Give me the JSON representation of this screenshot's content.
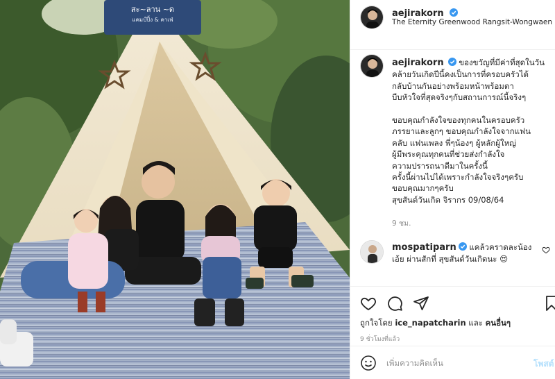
{
  "post": {
    "username": "aejirakorn",
    "location": "The Eternity Greenwood Rangsit-Wongwaen",
    "caption_lines_1": [
      "ของขวัญที่มีค่าที่สุดในวัน",
      "คล้ายวันเกิดปีนี้คงเป็นการที่ครอบครัวได้",
      "กลับบ้านกันอย่างพร้อมหน้าพร้อมตา",
      "บีบหัวใจที่สุดจริงๆกับสถานการณ์นี้จริงๆ"
    ],
    "caption_lines_2": [
      "ขอบคุณกำลังใจของทุกคนในครอบครัว",
      "ภรรยาและลูกๆ ขอบคุณกำลังใจจากแฟน",
      "คลับ แฟนเพลง พี่ๆน้องๆ ผู้หลักผู้ใหญ่",
      "ผู้มีพระคุณทุกคนที่ช่วยส่งกำลังใจ",
      "ความปรารถนาดีมาในครั้งนี้",
      "ครั้งนี้ผ่านไปได้เพราะกำลังใจจริงๆครับ",
      "ขอบคุณมากๆครับ",
      "สุขสันต์วันเกิด จิรากร 09/08/64"
    ],
    "caption_time": "9 ชม.",
    "photo_banner": "สะ~ลาน ~ด",
    "photo_banner_sub": "แคมป์ปิ้ง & คาเฟ่"
  },
  "comment": {
    "username": "mospatiparn",
    "text": "แคล้วคราดละน้อง เอ้ย ผ่านสักที่ สุขสันต์วันเกิดนะ",
    "emoji": "😍"
  },
  "actions": {
    "liked_by_prefix": "ถูกใจโดย",
    "liked_by_user": "ice_napatcharin",
    "liked_by_and": "และ",
    "liked_by_others": "คนอื่นๆ",
    "post_time": "9 ชั่วโมงที่แล้ว"
  },
  "add_comment": {
    "placeholder": "เพิ่มความคิดเห็น",
    "post_label": "โพสต์"
  },
  "colors": {
    "verified": "#3897f0",
    "post_disabled": "#b2dffc"
  },
  "icons": {
    "like": "heart-icon",
    "comment": "comment-icon",
    "share": "share-icon",
    "save": "bookmark-icon",
    "emoji": "emoji-icon"
  }
}
